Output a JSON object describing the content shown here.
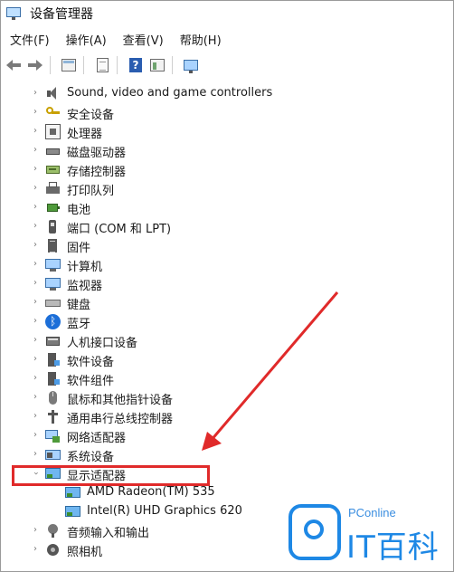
{
  "window": {
    "title": "设备管理器"
  },
  "menubar": {
    "items": [
      {
        "label": "文件(F)"
      },
      {
        "label": "操作(A)"
      },
      {
        "label": "查看(V)"
      },
      {
        "label": "帮助(H)"
      }
    ]
  },
  "toolbar": {
    "buttons": [
      "back-icon",
      "forward-icon",
      "show-hide-console-tree-icon",
      "properties-icon",
      "help-icon",
      "action-pane-icon",
      "display-monitor-icon"
    ]
  },
  "tree": {
    "items": [
      {
        "label": "Sound, video and game controllers",
        "icon": "speaker-icon",
        "expanded": false
      },
      {
        "label": "安全设备",
        "icon": "security-key-icon",
        "expanded": false
      },
      {
        "label": "处理器",
        "icon": "processor-chip-icon",
        "expanded": false
      },
      {
        "label": "磁盘驱动器",
        "icon": "disk-drive-icon",
        "expanded": false
      },
      {
        "label": "存储控制器",
        "icon": "storage-controller-icon",
        "expanded": false
      },
      {
        "label": "打印队列",
        "icon": "printer-icon",
        "expanded": false
      },
      {
        "label": "电池",
        "icon": "battery-icon",
        "expanded": false
      },
      {
        "label": "端口 (COM 和 LPT)",
        "icon": "port-icon",
        "expanded": false
      },
      {
        "label": "固件",
        "icon": "firmware-icon",
        "expanded": false
      },
      {
        "label": "计算机",
        "icon": "computer-icon",
        "expanded": false
      },
      {
        "label": "监视器",
        "icon": "monitor-icon",
        "expanded": false
      },
      {
        "label": "键盘",
        "icon": "keyboard-icon",
        "expanded": false
      },
      {
        "label": "蓝牙",
        "icon": "bluetooth-icon",
        "expanded": false
      },
      {
        "label": "人机接口设备",
        "icon": "hid-icon",
        "expanded": false
      },
      {
        "label": "软件设备",
        "icon": "software-device-icon",
        "expanded": false
      },
      {
        "label": "软件组件",
        "icon": "software-component-icon",
        "expanded": false
      },
      {
        "label": "鼠标和其他指针设备",
        "icon": "mouse-icon",
        "expanded": false
      },
      {
        "label": "通用串行总线控制器",
        "icon": "usb-icon",
        "expanded": false
      },
      {
        "label": "网络适配器",
        "icon": "network-adapter-icon",
        "expanded": false
      },
      {
        "label": "系统设备",
        "icon": "system-device-icon",
        "expanded": false
      },
      {
        "label": "显示适配器",
        "icon": "display-adapter-icon",
        "expanded": true,
        "children": [
          {
            "label": "AMD Radeon(TM) 535",
            "icon": "display-adapter-icon"
          },
          {
            "label": "Intel(R) UHD Graphics 620",
            "icon": "display-adapter-icon"
          }
        ]
      },
      {
        "label": "音频输入和输出",
        "icon": "audio-icon",
        "expanded": false
      },
      {
        "label": "照相机",
        "icon": "camera-icon",
        "expanded": false
      }
    ]
  },
  "annotation": {
    "highlight_color": "#e02a2a",
    "arrow_color": "#e02a2a"
  },
  "watermark": {
    "small_text": "PConline",
    "big_text": "IT百科",
    "color": "#1e88e5"
  }
}
